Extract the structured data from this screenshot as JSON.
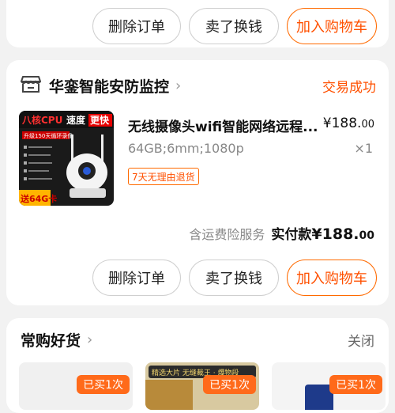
{
  "top_card": {
    "buttons": [
      "删除订单",
      "卖了换钱",
      "加入购物车"
    ]
  },
  "order": {
    "store_icon": "store-icon",
    "store_name": "华銮智能安防监控",
    "status": "交易成功",
    "product": {
      "title": "无线摄像头wifi智能网络远程...",
      "price_main": "¥188.",
      "price_cents": "00",
      "spec": "64GB;6mm;1080p",
      "quantity": "×1",
      "tag": "7天无理由退货",
      "thumb_text_top": "八核CPU 速度更快",
      "thumb_text_sub": "升级150天循环录像",
      "thumb_text_badge": "送64G卡"
    },
    "shipping_note": "含运费险服务",
    "paid_label": "实付款",
    "paid_main": "¥188.",
    "paid_cents": "00",
    "buttons": [
      "删除订单",
      "卖了换钱",
      "加入购物车"
    ]
  },
  "recommend": {
    "title": "常购好货",
    "close": "关闭",
    "items": [
      {
        "badge": "已买1次"
      },
      {
        "badge": "已买1次",
        "caption": "精选大片 无缝裁王 · 爆物段"
      },
      {
        "badge": "已买1次"
      }
    ]
  },
  "colors": {
    "accent": "#ff5000",
    "background": "#f2f2f2"
  }
}
